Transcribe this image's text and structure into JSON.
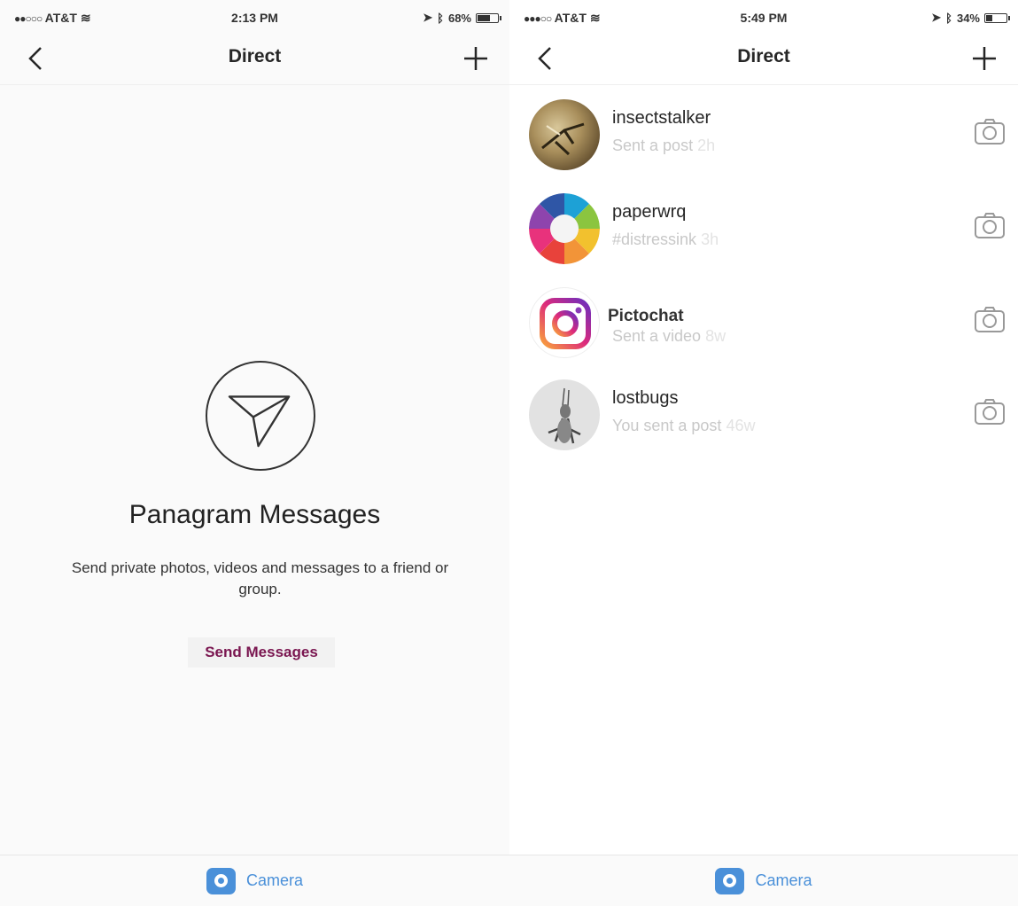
{
  "left": {
    "status": {
      "carrier": "AT&T",
      "time": "2:13 PM",
      "battery": "68%",
      "battery_level": 0.68
    },
    "nav": {
      "title": "Direct"
    },
    "empty_state": {
      "title": "Panagram Messages",
      "description": "Send private photos, videos and messages to a friend or group.",
      "action_label": "Send Messages"
    },
    "tabbar": {
      "camera_label": "Camera"
    }
  },
  "right": {
    "status": {
      "carrier": "AT&T",
      "time": "5:49 PM",
      "battery": "34%",
      "battery_level": 0.34
    },
    "nav": {
      "title": "Direct"
    },
    "threads": [
      {
        "username": "insectstalker",
        "preview": "Sent a post",
        "age": "2h"
      },
      {
        "username": "paperwrq",
        "preview": "#distressink",
        "age": "3h"
      },
      {
        "username": "Pictochat",
        "preview": "Sent a video",
        "age": "8w"
      },
      {
        "username": "lostbugs",
        "preview": "You sent a post",
        "age": "46w"
      }
    ],
    "tabbar": {
      "camera_label": "Camera"
    }
  },
  "colors": {
    "accent_blue": "#4a90d9",
    "action_text": "#7a1650",
    "muted_text": "#c8c8c8"
  }
}
